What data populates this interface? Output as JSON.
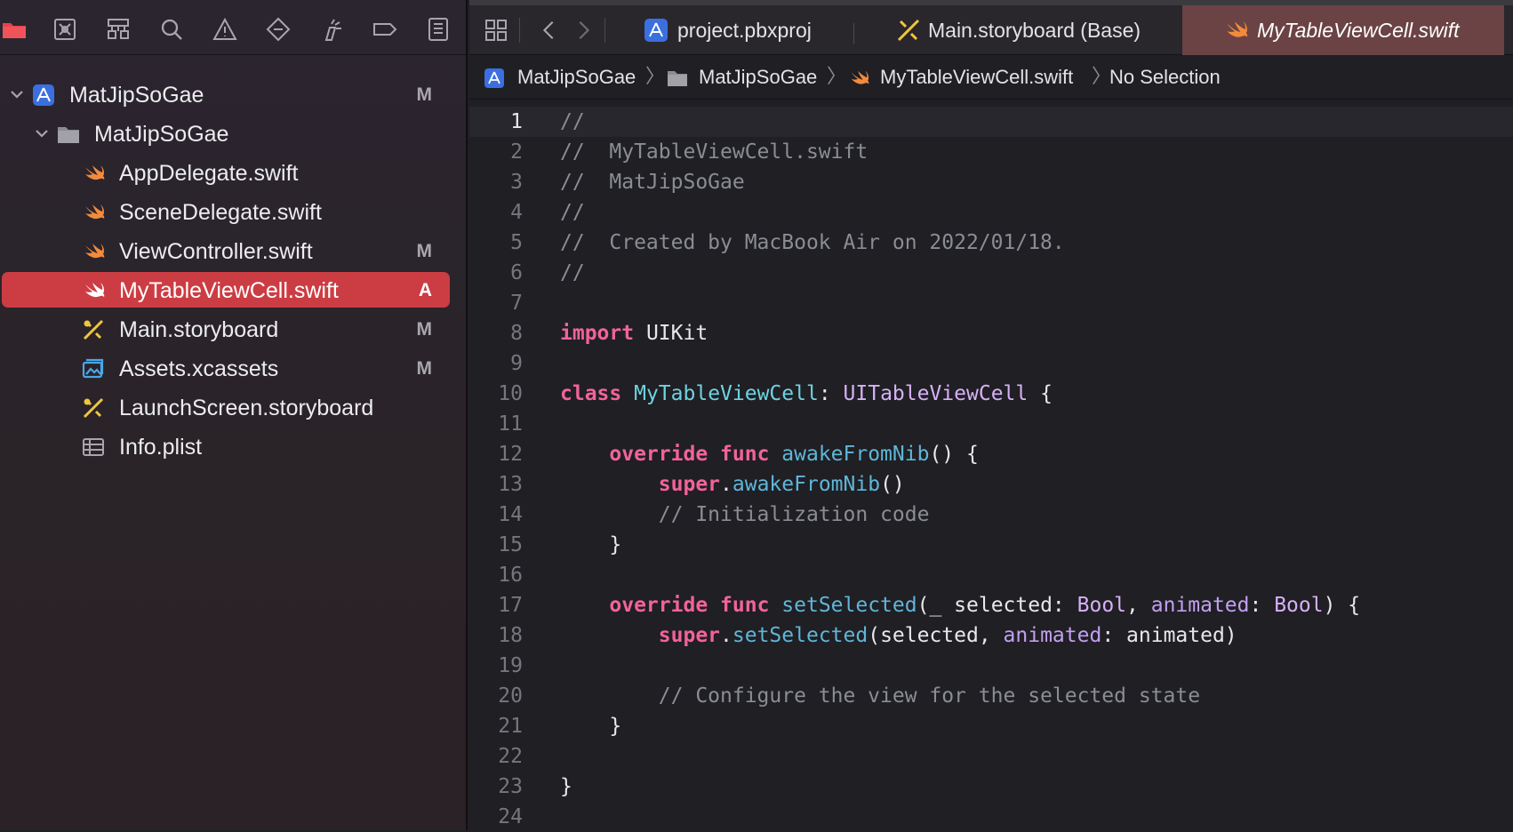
{
  "colors": {
    "selection": "#cc3d43",
    "swift_icon": "#f28b3c",
    "storyboard_icon": "#f0c63a",
    "project_icon": "#3b6fe0",
    "keyword": "#f2639a",
    "type": "#6fd3e0",
    "function": "#5fb6d8",
    "comment": "#8a8d93"
  },
  "navigator": {
    "toolbar_icons": [
      "folder-icon",
      "source-control-icon",
      "hierarchy-icon",
      "search-icon",
      "warning-icon",
      "breakpoint-icon",
      "debug-icon",
      "tag-icon",
      "report-icon"
    ],
    "items": [
      {
        "label": "MatJipSoGae",
        "badge": "M",
        "icon": "project-icon",
        "expanded": true
      },
      {
        "label": "MatJipSoGae",
        "badge": "",
        "icon": "folder-icon",
        "expanded": true
      },
      {
        "label": "AppDelegate.swift",
        "badge": "",
        "icon": "swift-icon"
      },
      {
        "label": "SceneDelegate.swift",
        "badge": "",
        "icon": "swift-icon"
      },
      {
        "label": "ViewController.swift",
        "badge": "M",
        "icon": "swift-icon"
      },
      {
        "label": "MyTableViewCell.swift",
        "badge": "A",
        "icon": "swift-icon",
        "selected": true
      },
      {
        "label": "Main.storyboard",
        "badge": "M",
        "icon": "storyboard-icon"
      },
      {
        "label": "Assets.xcassets",
        "badge": "M",
        "icon": "assets-icon"
      },
      {
        "label": "LaunchScreen.storyboard",
        "badge": "",
        "icon": "storyboard-icon"
      },
      {
        "label": "Info.plist",
        "badge": "",
        "icon": "plist-icon"
      }
    ]
  },
  "tabs": [
    {
      "label": "project.pbxproj",
      "icon": "project-icon"
    },
    {
      "label": "Main.storyboard (Base)",
      "icon": "storyboard-icon"
    },
    {
      "label": "MyTableViewCell.swift",
      "icon": "swift-icon",
      "active": true
    }
  ],
  "jumpbar": {
    "items": [
      "MatJipSoGae",
      "MatJipSoGae",
      "MyTableViewCell.swift",
      "No Selection"
    ]
  },
  "editor": {
    "current_line": 1,
    "lines": [
      [
        [
          "c",
          "//"
        ]
      ],
      [
        [
          "c",
          "//  MyTableViewCell.swift"
        ]
      ],
      [
        [
          "c",
          "//  MatJipSoGae"
        ]
      ],
      [
        [
          "c",
          "//"
        ]
      ],
      [
        [
          "c",
          "//  Created by MacBook Air on 2022/01/18."
        ]
      ],
      [
        [
          "c",
          "//"
        ]
      ],
      [],
      [
        [
          "k",
          "import"
        ],
        [
          "p",
          " UIKit"
        ]
      ],
      [],
      [
        [
          "k",
          "class"
        ],
        [
          "p",
          " "
        ],
        [
          "t",
          "MyTableViewCell"
        ],
        [
          "p",
          ": "
        ],
        [
          "s",
          "UITableViewCell"
        ],
        [
          "p",
          " {"
        ]
      ],
      [],
      [
        [
          "p",
          "    "
        ],
        [
          "k",
          "override"
        ],
        [
          "p",
          " "
        ],
        [
          "k",
          "func"
        ],
        [
          "p",
          " "
        ],
        [
          "f",
          "awakeFromNib"
        ],
        [
          "p",
          "() {"
        ]
      ],
      [
        [
          "p",
          "        "
        ],
        [
          "k",
          "super"
        ],
        [
          "p",
          "."
        ],
        [
          "f",
          "awakeFromNib"
        ],
        [
          "p",
          "()"
        ]
      ],
      [
        [
          "p",
          "        "
        ],
        [
          "c",
          "// Initialization code"
        ]
      ],
      [
        [
          "p",
          "    }"
        ]
      ],
      [],
      [
        [
          "p",
          "    "
        ],
        [
          "k",
          "override"
        ],
        [
          "p",
          " "
        ],
        [
          "k",
          "func"
        ],
        [
          "p",
          " "
        ],
        [
          "f",
          "setSelected"
        ],
        [
          "p",
          "(_ selected: "
        ],
        [
          "s",
          "Bool"
        ],
        [
          "p",
          ", "
        ],
        [
          "a",
          "animated"
        ],
        [
          "p",
          ": "
        ],
        [
          "s",
          "Bool"
        ],
        [
          "p",
          ") {"
        ]
      ],
      [
        [
          "p",
          "        "
        ],
        [
          "k",
          "super"
        ],
        [
          "p",
          "."
        ],
        [
          "f",
          "setSelected"
        ],
        [
          "p",
          "(selected, "
        ],
        [
          "a",
          "animated"
        ],
        [
          "p",
          ": animated)"
        ]
      ],
      [],
      [
        [
          "p",
          "        "
        ],
        [
          "c",
          "// Configure the view for the selected state"
        ]
      ],
      [
        [
          "p",
          "    }"
        ]
      ],
      [],
      [
        [
          "p",
          "}"
        ]
      ],
      []
    ]
  }
}
